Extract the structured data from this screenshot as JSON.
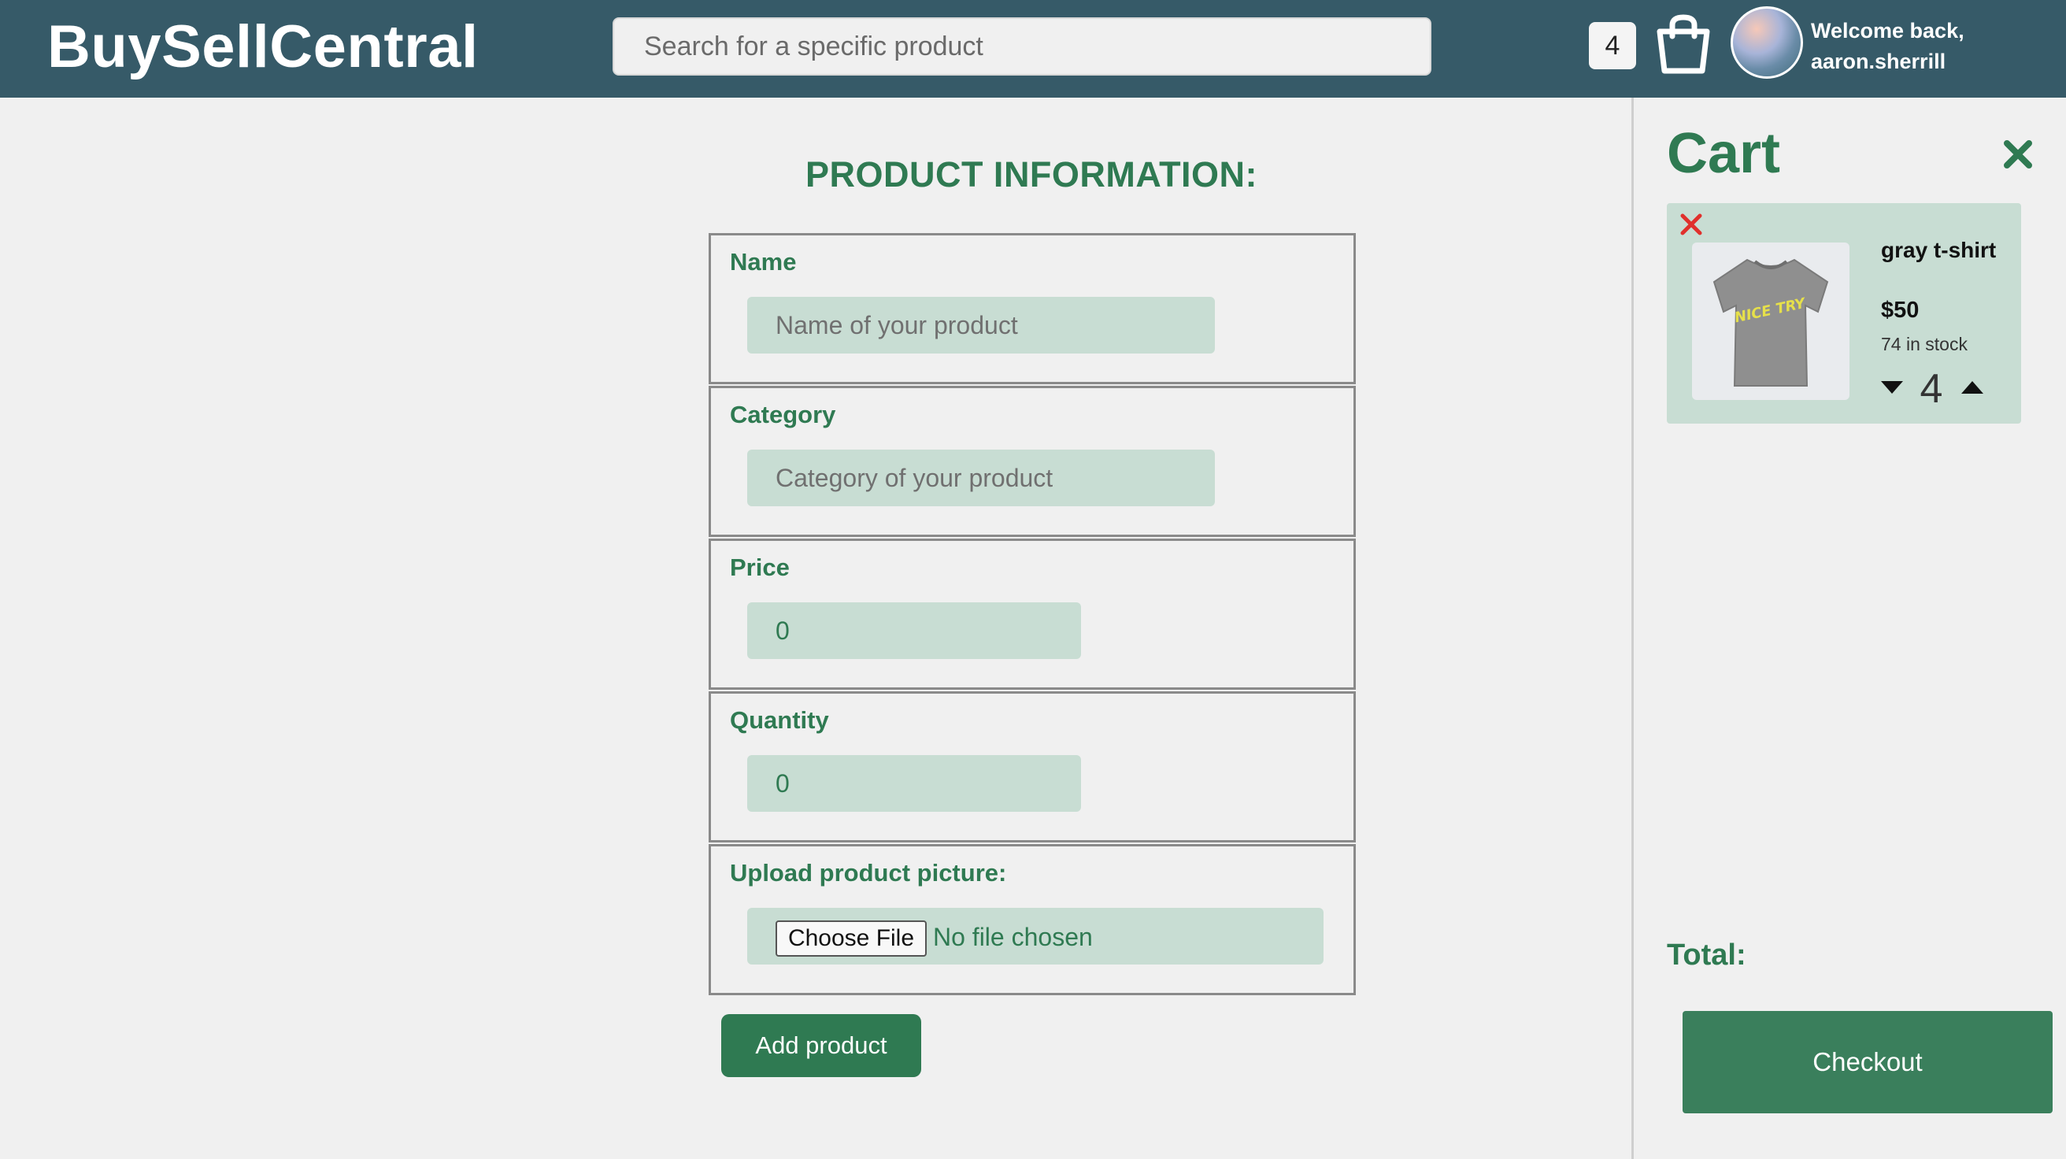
{
  "header": {
    "logo": "BuySellCentral",
    "search_placeholder": "Search for a specific product",
    "cart_count": "4",
    "welcome_line1": "Welcome back,",
    "welcome_line2": "aaron.sherrill",
    "icons": {
      "bag": "shopping-bag-icon",
      "avatar": "user-avatar"
    }
  },
  "form": {
    "title": "PRODUCT INFORMATION:",
    "fields": [
      {
        "label": "Name",
        "placeholder": "Name of your product",
        "value": ""
      },
      {
        "label": "Category",
        "placeholder": "Category of your product",
        "value": ""
      },
      {
        "label": "Price",
        "placeholder": "",
        "value": "0"
      },
      {
        "label": "Quantity",
        "placeholder": "",
        "value": "0"
      }
    ],
    "upload": {
      "label": "Upload product picture:",
      "button": "Choose File",
      "status": "No file chosen"
    },
    "submit": "Add product"
  },
  "cart": {
    "title": "Cart",
    "items": [
      {
        "name": "gray t-shirt",
        "price": "$50",
        "stock": "74 in stock",
        "quantity": "4",
        "image": "gray-tshirt-image",
        "image_text": "NICE TRY"
      }
    ],
    "total_label": "Total:",
    "checkout": "Checkout"
  },
  "colors": {
    "header": "#365a68",
    "accent_green": "#2f7a52",
    "input_bg": "#c8ddd3",
    "page_bg": "#f0f0f0",
    "remove_red": "#e0302c"
  }
}
